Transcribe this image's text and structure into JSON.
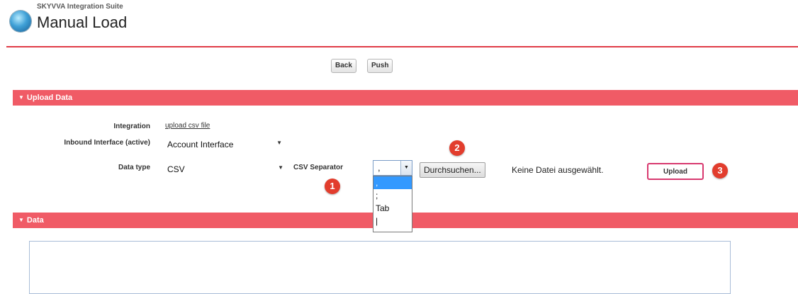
{
  "header": {
    "app_name": "SKYVVA Integration Suite",
    "title": "Manual Load"
  },
  "toolbar": {
    "back_label": "Back",
    "push_label": "Push"
  },
  "upload_section": {
    "title": "Upload Data",
    "integration_label": "Integration",
    "integration_value": "upload csv file",
    "inbound_label": "Inbound Interface (active)",
    "inbound_value": "Account Interface",
    "datatype_label": "Data type",
    "datatype_value": "CSV",
    "csv_separator_label": "CSV Separator",
    "csv_separator_value": ",",
    "csv_separator_options": [
      ",",
      ";",
      "Tab",
      "|"
    ],
    "browse_label": "Durchsuchen...",
    "file_status": "Keine Datei ausgewählt.",
    "upload_label": "Upload"
  },
  "data_section": {
    "title": "Data",
    "content": ""
  },
  "markers": [
    "1",
    "2",
    "3"
  ],
  "colors": {
    "section_header": "#f05b66",
    "rule": "#e03c47",
    "marker": "#e23d2d",
    "upload_highlight": "#d8396f",
    "dropdown_selected": "#3399ff"
  }
}
